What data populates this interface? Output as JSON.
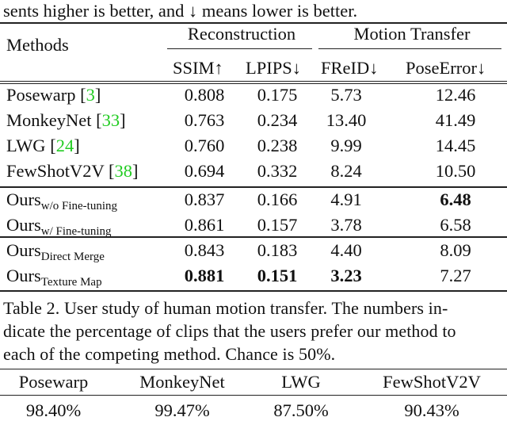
{
  "preceding_text": "sents higher is better, and ↓ means lower is better.",
  "table1": {
    "header": {
      "methods": "Methods",
      "groups": [
        "Reconstruction",
        "Motion Transfer"
      ],
      "columns": [
        "SSIM↑",
        "LPIPS↓",
        "FReID↓",
        "PoseError↓"
      ]
    },
    "rows": [
      {
        "name": "Posewarp",
        "sub": "",
        "cite": "3",
        "values": [
          "0.808",
          "0.175",
          "5.73",
          "12.46"
        ],
        "bold": [
          false,
          false,
          false,
          false
        ]
      },
      {
        "name": "MonkeyNet",
        "sub": "",
        "cite": "33",
        "values": [
          "0.763",
          "0.234",
          "13.40",
          "41.49"
        ],
        "bold": [
          false,
          false,
          false,
          false
        ]
      },
      {
        "name": "LWG",
        "sub": "",
        "cite": "24",
        "values": [
          "0.760",
          "0.238",
          "9.99",
          "14.45"
        ],
        "bold": [
          false,
          false,
          false,
          false
        ]
      },
      {
        "name": "FewShotV2V",
        "sub": "",
        "cite": "38",
        "values": [
          "0.694",
          "0.332",
          "8.24",
          "10.50"
        ],
        "bold": [
          false,
          false,
          false,
          false
        ]
      },
      {
        "name": "Ours",
        "sub": "w/o Fine-tuning",
        "cite": "",
        "values": [
          "0.837",
          "0.166",
          "4.91",
          "6.48"
        ],
        "bold": [
          false,
          false,
          false,
          true
        ]
      },
      {
        "name": "Ours",
        "sub": "w/ Fine-tuning",
        "cite": "",
        "values": [
          "0.861",
          "0.157",
          "3.78",
          "6.58"
        ],
        "bold": [
          false,
          false,
          false,
          false
        ]
      },
      {
        "name": "Ours",
        "sub": "Direct Merge",
        "cite": "",
        "values": [
          "0.843",
          "0.183",
          "4.40",
          "8.09"
        ],
        "bold": [
          false,
          false,
          false,
          false
        ]
      },
      {
        "name": "Ours",
        "sub": "Texture Map",
        "cite": "",
        "values": [
          "0.881",
          "0.151",
          "3.23",
          "7.27"
        ],
        "bold": [
          true,
          true,
          true,
          false
        ]
      }
    ]
  },
  "caption2": [
    "Table 2. User study of human motion transfer.  The numbers in-",
    "dicate the percentage of clips that the users prefer our method to",
    "each of the competing method. Chance is 50%."
  ],
  "table2": {
    "columns": [
      "Posewarp",
      "MonkeyNet",
      "LWG",
      "FewShotV2V"
    ],
    "values": [
      "98.40%",
      "99.47%",
      "87.50%",
      "90.43%"
    ]
  },
  "colors": {
    "citation": "#22cc22",
    "text": "#111111",
    "rule": "#222222"
  }
}
